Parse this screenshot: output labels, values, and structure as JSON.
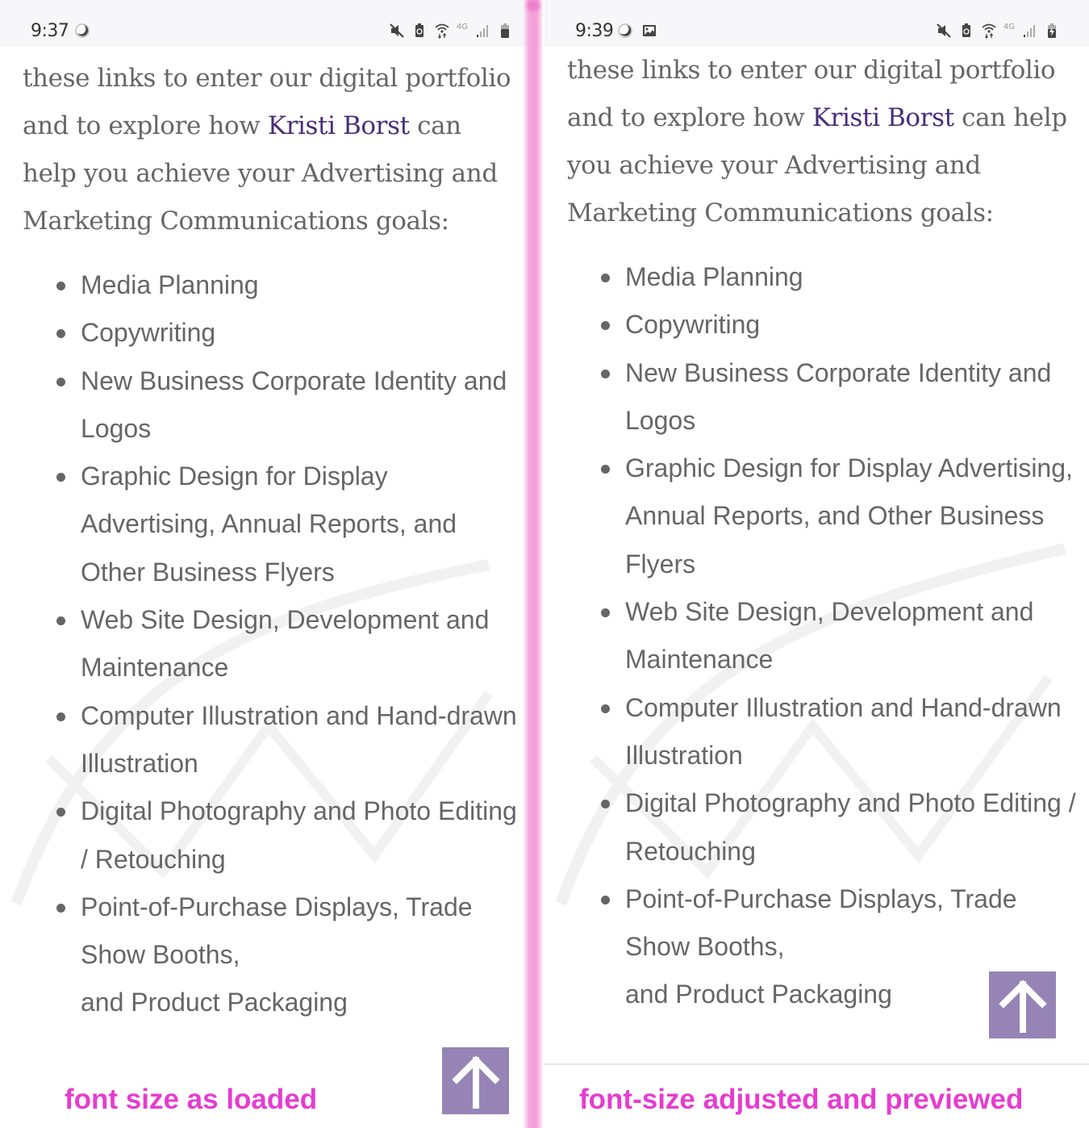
{
  "panels": [
    {
      "id": "left",
      "status_bar": {
        "time": "9:37",
        "left_icons": [
          "moon-icon"
        ],
        "right_icons": [
          "mute-icon",
          "battery-saver-icon",
          "wifi-data-icon",
          "lte-indicator",
          "signal-icon",
          "battery-icon"
        ],
        "network_label": "4G"
      },
      "intro": {
        "text_before_link": "these links to enter our digital portfolio and to explore how ",
        "link_text": "Kristi Borst",
        "text_after_link": " can help you achieve your Advertising and Marketing Communications goals:"
      },
      "services": [
        "Media Planning",
        "Copywriting",
        "New Business Corporate Identity and Logos",
        "Graphic Design for Display Advertising, Annual Reports, and Other Business Flyers",
        "Web Site Design, Development and Maintenance",
        "Computer Illustration and Hand-drawn Illustration",
        "Digital Photography and Photo Editing / Retouching",
        "Point-of-Purchase Displays, Trade Show Booths,\nand Product Packaging"
      ],
      "scroll_top_button": {
        "icon": "arrow-up-icon",
        "color": "#9584b5"
      },
      "caption": "font size as loaded"
    },
    {
      "id": "right",
      "status_bar": {
        "time": "9:39",
        "left_icons": [
          "moon-icon",
          "image-icon"
        ],
        "right_icons": [
          "mute-icon",
          "battery-saver-icon",
          "wifi-data-icon",
          "lte-indicator",
          "signal-icon",
          "battery-charging-icon"
        ],
        "network_label": "4G"
      },
      "intro": {
        "text_before_link": "these links to enter our digital portfolio and to explore how ",
        "link_text": "Kristi Borst",
        "text_after_link": " can help you achieve your Advertising and Marketing Communications goals:"
      },
      "services": [
        "Media Planning",
        "Copywriting",
        "New Business Corporate Identity and Logos",
        "Graphic Design for Display Advertising, Annual Reports, and Other Business Flyers",
        "Web Site Design, Development and Maintenance",
        "Computer Illustration and Hand-drawn Illustration",
        "Digital Photography and Photo Editing / Retouching",
        "Point-of-Purchase Displays, Trade Show Booths,\nand Product Packaging"
      ],
      "scroll_top_button": {
        "icon": "arrow-up-icon",
        "color": "#9584b5"
      },
      "caption": "font-size adjusted and previewed"
    }
  ],
  "colors": {
    "body_text": "#666666",
    "link": "#4a2d7a",
    "caption": "#e63ccf",
    "divider": "#f3a0d8",
    "button": "#9584b5"
  }
}
